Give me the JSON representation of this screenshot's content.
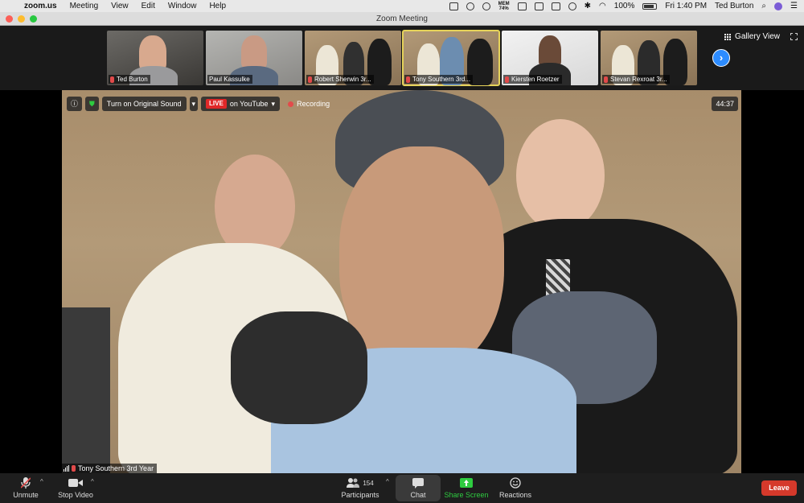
{
  "menubar": {
    "app_name": "zoom.us",
    "menus": [
      "Meeting",
      "View",
      "Edit",
      "Window",
      "Help"
    ],
    "memory_label": "MEM",
    "memory_value": "74%",
    "battery": "100%",
    "clock": "Fri 1:40 PM",
    "user": "Ted Burton"
  },
  "window": {
    "title": "Zoom Meeting"
  },
  "gallery": {
    "view_label": "Gallery View",
    "participants": [
      {
        "name": "Ted Burton"
      },
      {
        "name": "Paul Kassulke"
      },
      {
        "name": "Robert Sherwin 3r..."
      },
      {
        "name": "Tony Southern 3rd..."
      },
      {
        "name": "Kiersten Roetzer"
      },
      {
        "name": "Stevan Rexroat 3r..."
      }
    ]
  },
  "meeting": {
    "original_sound_label": "Turn on Original Sound",
    "live_label": "LIVE",
    "live_target": "on YouTube",
    "recording_label": "Recording",
    "elapsed": "44:37",
    "active_speaker": "Tony Southern 3rd Year"
  },
  "toolbar": {
    "unmute": "Unmute",
    "stop_video": "Stop Video",
    "participants": "Participants",
    "participant_count": "154",
    "chat": "Chat",
    "share_screen": "Share Screen",
    "reactions": "Reactions",
    "leave": "Leave"
  },
  "colors": {
    "accent_blue": "#2d8cff",
    "leave_red": "#d5392b",
    "share_green": "#2ecc40",
    "active_border": "#e6d35a"
  }
}
